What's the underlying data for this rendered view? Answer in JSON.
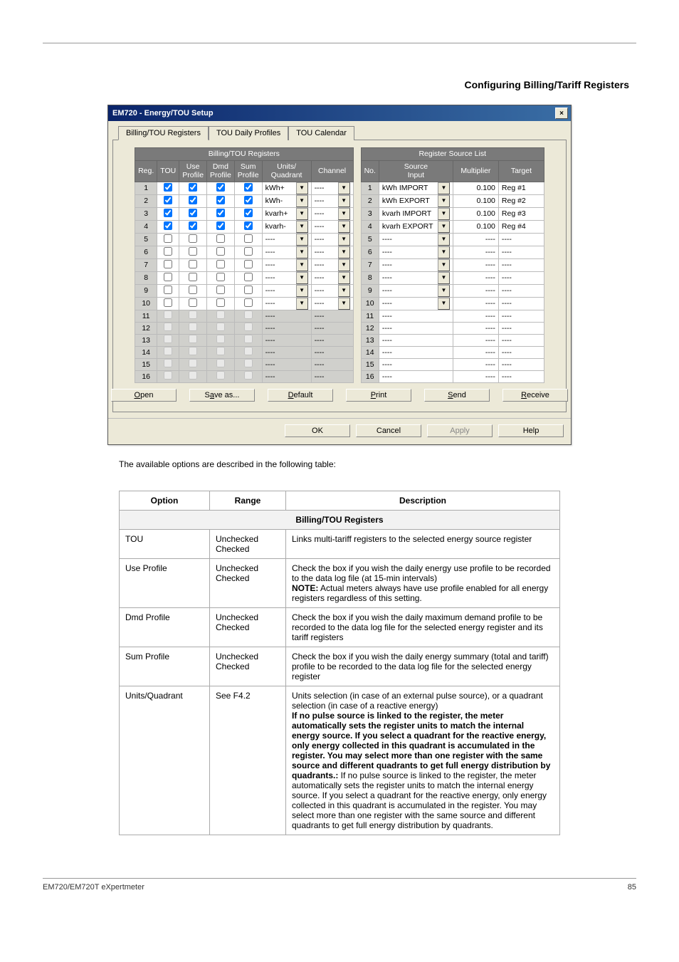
{
  "doc": {
    "heading": "Configuring Billing/Tariff Registers",
    "dialog_title": "EM720 - Energy/TOU Setup",
    "tabs": [
      "Billing/TOU Registers",
      "TOU Daily Profiles",
      "TOU Calendar"
    ],
    "left_table_title": "Billing/TOU Registers",
    "right_table_title": "Register Source List",
    "left_headers": [
      "Reg.",
      "TOU",
      "Use\nProfile",
      "Dmd\nProfile",
      "Sum\nProfile",
      "Units/\nQuadrant",
      "Channel"
    ],
    "right_headers": [
      "No.",
      "Source\nInput",
      "Multiplier",
      "Target"
    ],
    "rows_left": [
      {
        "reg": "1",
        "tou": true,
        "use": true,
        "dmd": true,
        "sum": true,
        "units": "kWh+",
        "hasDD": true,
        "channel": "----",
        "active": true
      },
      {
        "reg": "2",
        "tou": true,
        "use": true,
        "dmd": true,
        "sum": true,
        "units": "kWh-",
        "hasDD": true,
        "channel": "----",
        "active": true
      },
      {
        "reg": "3",
        "tou": true,
        "use": true,
        "dmd": true,
        "sum": true,
        "units": "kvarh+",
        "hasDD": true,
        "channel": "----",
        "active": true
      },
      {
        "reg": "4",
        "tou": true,
        "use": true,
        "dmd": true,
        "sum": true,
        "units": "kvarh-",
        "hasDD": true,
        "channel": "----",
        "active": true
      },
      {
        "reg": "5",
        "tou": false,
        "use": false,
        "dmd": false,
        "sum": false,
        "units": "----",
        "hasDD": true,
        "channel": "----",
        "active": true
      },
      {
        "reg": "6",
        "tou": false,
        "use": false,
        "dmd": false,
        "sum": false,
        "units": "----",
        "hasDD": true,
        "channel": "----",
        "active": true
      },
      {
        "reg": "7",
        "tou": false,
        "use": false,
        "dmd": false,
        "sum": false,
        "units": "----",
        "hasDD": true,
        "channel": "----",
        "active": true
      },
      {
        "reg": "8",
        "tou": false,
        "use": false,
        "dmd": false,
        "sum": false,
        "units": "----",
        "hasDD": true,
        "channel": "----",
        "active": true
      },
      {
        "reg": "9",
        "tou": false,
        "use": false,
        "dmd": false,
        "sum": false,
        "units": "----",
        "hasDD": true,
        "channel": "----",
        "active": true
      },
      {
        "reg": "10",
        "tou": false,
        "use": false,
        "dmd": false,
        "sum": false,
        "units": "----",
        "hasDD": true,
        "channel": "----",
        "active": true
      },
      {
        "reg": "11",
        "tou": false,
        "use": false,
        "dmd": false,
        "sum": false,
        "units": "----",
        "hasDD": false,
        "channel": "----",
        "active": false
      },
      {
        "reg": "12",
        "tou": false,
        "use": false,
        "dmd": false,
        "sum": false,
        "units": "----",
        "hasDD": false,
        "channel": "----",
        "active": false
      },
      {
        "reg": "13",
        "tou": false,
        "use": false,
        "dmd": false,
        "sum": false,
        "units": "----",
        "hasDD": false,
        "channel": "----",
        "active": false
      },
      {
        "reg": "14",
        "tou": false,
        "use": false,
        "dmd": false,
        "sum": false,
        "units": "----",
        "hasDD": false,
        "channel": "----",
        "active": false
      },
      {
        "reg": "15",
        "tou": false,
        "use": false,
        "dmd": false,
        "sum": false,
        "units": "----",
        "hasDD": false,
        "channel": "----",
        "active": false
      },
      {
        "reg": "16",
        "tou": false,
        "use": false,
        "dmd": false,
        "sum": false,
        "units": "----",
        "hasDD": false,
        "channel": "----",
        "active": false
      }
    ],
    "rows_right": [
      {
        "no": "1",
        "src": "kWh IMPORT",
        "hasDD": true,
        "mult": "0.100",
        "target": "Reg #1"
      },
      {
        "no": "2",
        "src": "kWh EXPORT",
        "hasDD": true,
        "mult": "0.100",
        "target": "Reg #2"
      },
      {
        "no": "3",
        "src": "kvarh IMPORT",
        "hasDD": true,
        "mult": "0.100",
        "target": "Reg #3"
      },
      {
        "no": "4",
        "src": "kvarh EXPORT",
        "hasDD": true,
        "mult": "0.100",
        "target": "Reg #4"
      },
      {
        "no": "5",
        "src": "----",
        "hasDD": true,
        "mult": "----",
        "target": "----"
      },
      {
        "no": "6",
        "src": "----",
        "hasDD": true,
        "mult": "----",
        "target": "----"
      },
      {
        "no": "7",
        "src": "----",
        "hasDD": true,
        "mult": "----",
        "target": "----"
      },
      {
        "no": "8",
        "src": "----",
        "hasDD": true,
        "mult": "----",
        "target": "----"
      },
      {
        "no": "9",
        "src": "----",
        "hasDD": true,
        "mult": "----",
        "target": "----"
      },
      {
        "no": "10",
        "src": "----",
        "hasDD": true,
        "mult": "----",
        "target": "----"
      },
      {
        "no": "11",
        "src": "----",
        "hasDD": false,
        "mult": "----",
        "target": "----"
      },
      {
        "no": "12",
        "src": "----",
        "hasDD": false,
        "mult": "----",
        "target": "----"
      },
      {
        "no": "13",
        "src": "----",
        "hasDD": false,
        "mult": "----",
        "target": "----"
      },
      {
        "no": "14",
        "src": "----",
        "hasDD": false,
        "mult": "----",
        "target": "----"
      },
      {
        "no": "15",
        "src": "----",
        "hasDD": false,
        "mult": "----",
        "target": "----"
      },
      {
        "no": "16",
        "src": "----",
        "hasDD": false,
        "mult": "----",
        "target": "----"
      }
    ],
    "file_buttons": {
      "open": "Open",
      "saveas": "Save as...",
      "default": "Default",
      "print": "Print",
      "send": "Send",
      "receive": "Receive"
    },
    "dlg_buttons": {
      "ok": "OK",
      "cancel": "Cancel",
      "apply": "Apply",
      "help": "Help"
    },
    "opt_caption": "The available options are described in the following table:",
    "opt_headers": [
      "Option",
      "Range",
      "Description"
    ],
    "opt_section": "Billing/TOU Registers",
    "opt_rows": [
      {
        "opt": "TOU",
        "range": "Unchecked\nChecked",
        "desc": "Links multi-tariff registers to the selected energy source register"
      },
      {
        "opt": "Use Profile",
        "range": "Unchecked\nChecked",
        "desc": "Check the box if you wish the daily energy use profile to be recorded to the data log file (at 15-min intervals)",
        "note": "NOTE: Actual meters always have use profile enabled for all energy registers regardless of this setting."
      },
      {
        "opt": "Dmd Profile",
        "range": "Unchecked\nChecked",
        "desc": "Check the box if you wish the daily maximum demand profile to be recorded to the data log file for the selected energy register and its tariff registers"
      },
      {
        "opt": "Sum Profile",
        "range": "Unchecked\nChecked",
        "desc": "Check the box if you wish the daily energy summary (total and tariff) profile to be recorded to the data log file for the selected energy register"
      },
      {
        "opt": "Units/Quadrant",
        "range": "See F4.2",
        "desc": "Units selection (in case of an external pulse source), or a quadrant selection (in case of a reactive energy)",
        "note": "If no pulse source is linked to the register, the meter automatically sets the register units to match the internal energy source. If you select a quadrant for the reactive energy, only energy collected in this quadrant is accumulated in the register. You may select more than one register with the same source and different quadrants to get full energy distribution by quadrants."
      }
    ],
    "footer_left": "EM720/EM720T eXpertmeter",
    "footer_right": "85"
  }
}
